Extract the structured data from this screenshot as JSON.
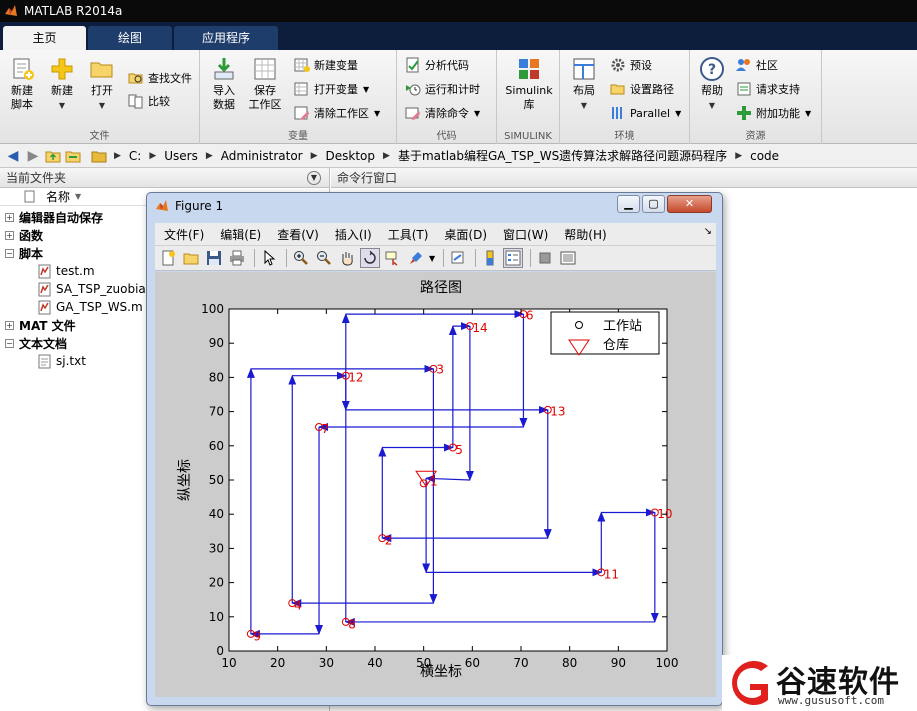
{
  "app": {
    "title": "MATLAB R2014a"
  },
  "tabs": [
    {
      "label": "主页",
      "active": true
    },
    {
      "label": "绘图",
      "active": false
    },
    {
      "label": "应用程序",
      "active": false
    }
  ],
  "ribbon": {
    "file": {
      "label": "文件",
      "new_script": "新建\n脚本",
      "new": "新建",
      "open": "打开",
      "find_files": "查找文件",
      "compare": "比较"
    },
    "variable": {
      "label": "变量",
      "import_data": "导入\n数据",
      "save_workspace": "保存\n工作区",
      "new_variable": "新建变量",
      "open_variable": "打开变量",
      "clear_workspace": "清除工作区"
    },
    "code": {
      "label": "代码",
      "analyze_code": "分析代码",
      "run_and_time": "运行和计时",
      "clear_commands": "清除命令"
    },
    "simulink": {
      "label": "SIMULINK",
      "library": "Simulink\n库"
    },
    "environment": {
      "label": "环境",
      "layout": "布局",
      "preferences": "预设",
      "set_path": "设置路径",
      "parallel": "Parallel"
    },
    "resources": {
      "label": "资源",
      "help": "帮助",
      "community": "社区",
      "request_support": "请求支持",
      "addons": "附加功能"
    }
  },
  "address": {
    "crumbs": [
      "C:",
      "Users",
      "Administrator",
      "Desktop",
      "基于matlab编程GA_TSP_WS遗传算法求解路径问题源码程序",
      "code"
    ]
  },
  "current_folder": {
    "title": "当前文件夹",
    "column_name": "名称",
    "tree": [
      {
        "type": "group",
        "label": "编辑器自动保存",
        "expanded": false
      },
      {
        "type": "group",
        "label": "函数",
        "expanded": false
      },
      {
        "type": "group",
        "label": "脚本",
        "expanded": true
      },
      {
        "type": "file",
        "label": "test.m"
      },
      {
        "type": "file",
        "label": "SA_TSP_zuobiao"
      },
      {
        "type": "file",
        "label": "GA_TSP_WS.m"
      },
      {
        "type": "group",
        "label": "MAT 文件",
        "expanded": false
      },
      {
        "type": "group",
        "label": "文本文档",
        "expanded": true
      },
      {
        "type": "file",
        "label": "sj.txt"
      }
    ]
  },
  "command_window": {
    "title": "命令行窗口"
  },
  "figure": {
    "title": "Figure 1",
    "menu": [
      "文件(F)",
      "编辑(E)",
      "查看(V)",
      "插入(I)",
      "工具(T)",
      "桌面(D)",
      "窗口(W)",
      "帮助(H)"
    ],
    "toolbar_icons": [
      "new-figure-icon",
      "open-file-icon",
      "save-icon",
      "print-icon",
      "pointer-icon",
      "zoom-in-icon",
      "zoom-out-icon",
      "pan-icon",
      "rotate-icon",
      "data-cursor-icon",
      "brush-icon",
      "link-icon",
      "colorbar-icon",
      "legend-icon",
      "hide-plot-tools-icon",
      "show-plot-tools-icon"
    ]
  },
  "chart_data": {
    "type": "scatter",
    "title": "路径图",
    "xlabel": "横坐标",
    "ylabel": "纵坐标",
    "xlim": [
      10,
      100
    ],
    "ylim": [
      0,
      100
    ],
    "xticks": [
      10,
      20,
      30,
      40,
      50,
      60,
      70,
      80,
      90,
      100
    ],
    "yticks": [
      0,
      10,
      20,
      30,
      40,
      50,
      60,
      70,
      80,
      90,
      100
    ],
    "grid": false,
    "legend_position": "top-right",
    "legend": [
      {
        "label": "工作站",
        "marker": "circle"
      },
      {
        "label": "仓库",
        "marker": "triangle-down"
      }
    ],
    "depot": {
      "x": 50.5,
      "y": 50.5
    },
    "stations": [
      {
        "x": 14.5,
        "y": 5
      },
      {
        "x": 41.5,
        "y": 33
      },
      {
        "x": 52,
        "y": 82.5
      },
      {
        "x": 23,
        "y": 14
      },
      {
        "x": 56,
        "y": 59.5
      },
      {
        "x": 70.5,
        "y": 98.5
      },
      {
        "x": 28.5,
        "y": 65.5
      },
      {
        "x": 34,
        "y": 8.5
      },
      {
        "x": 50,
        "y": 49
      },
      {
        "x": 97.5,
        "y": 40.5
      },
      {
        "x": 86.5,
        "y": 23
      },
      {
        "x": 34,
        "y": 80.5
      },
      {
        "x": 75.5,
        "y": 70.5
      },
      {
        "x": 59.5,
        "y": 95
      }
    ],
    "station_labels": [
      {
        "text": "1",
        "x": 51.3,
        "y": 49.5
      },
      {
        "text": "2",
        "x": 42.0,
        "y": 32.3
      },
      {
        "text": "3",
        "x": 52.6,
        "y": 82.3
      },
      {
        "text": "4",
        "x": 23.4,
        "y": 13.3
      },
      {
        "text": "5",
        "x": 56.5,
        "y": 58.8
      },
      {
        "text": "6",
        "x": 71.0,
        "y": 98.1
      },
      {
        "text": "7",
        "x": 29.0,
        "y": 64.9
      },
      {
        "text": "8",
        "x": 34.5,
        "y": 7.8
      },
      {
        "text": "9",
        "x": 15.0,
        "y": 4.3
      },
      {
        "text": "10",
        "x": 98.0,
        "y": 40.0
      },
      {
        "text": "11",
        "x": 87.0,
        "y": 22.3
      },
      {
        "text": "12",
        "x": 34.5,
        "y": 80.0
      },
      {
        "text": "13",
        "x": 76.0,
        "y": 70.0
      },
      {
        "text": "14",
        "x": 60.0,
        "y": 94.4
      }
    ],
    "route": [
      [
        50.5,
        50.5
      ],
      [
        50.5,
        23
      ],
      [
        86.5,
        23
      ],
      [
        86.5,
        40.5
      ],
      [
        97.5,
        40.5
      ],
      [
        97.5,
        8.5
      ],
      [
        34,
        8.5
      ],
      [
        34,
        98.5
      ],
      [
        70.5,
        98.5
      ],
      [
        70.5,
        65.5
      ],
      [
        28.5,
        65.5
      ],
      [
        28.5,
        5
      ],
      [
        14.5,
        5
      ],
      [
        14.5,
        82.5
      ],
      [
        52,
        82.5
      ],
      [
        52,
        14
      ],
      [
        23,
        14
      ],
      [
        23,
        80.5
      ],
      [
        34,
        80.5
      ],
      [
        34,
        70.5
      ],
      [
        75.5,
        70.5
      ],
      [
        75.5,
        33
      ],
      [
        41.5,
        33
      ],
      [
        41.5,
        59.5
      ],
      [
        56,
        59.5
      ],
      [
        56,
        95
      ],
      [
        59.5,
        95
      ],
      [
        59.5,
        50
      ],
      [
        50.5,
        50.5
      ]
    ]
  },
  "watermark": {
    "brand": "谷速软件",
    "url": "www.gususoft.com"
  }
}
